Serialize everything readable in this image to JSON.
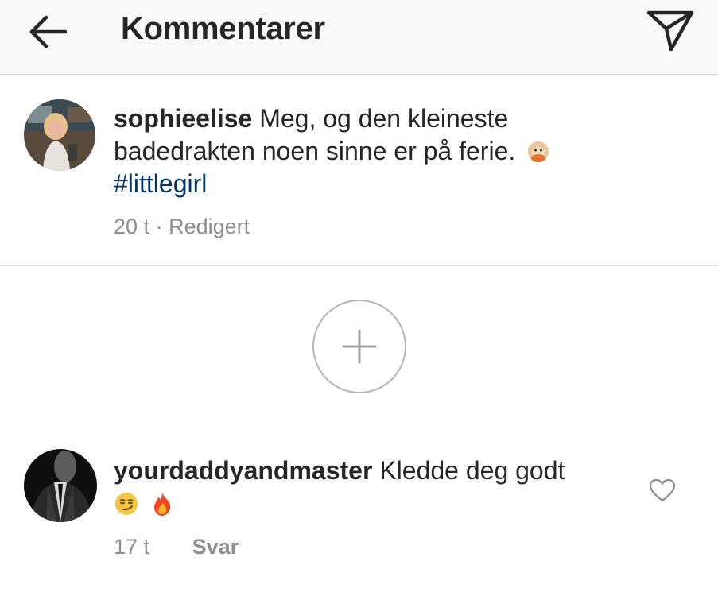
{
  "header": {
    "title": "Kommentarer",
    "back_icon": "arrow-left-icon",
    "send_icon": "paper-plane-icon"
  },
  "caption": {
    "username": "sophieelise",
    "text": "Meg, og den kleineste badedrakten noen sinne er på ferie.",
    "emoji": "🙊",
    "hashtag": "#littlegirl",
    "time": "20 t",
    "separator": "·",
    "edited": "Redigert"
  },
  "load_more": {
    "icon": "plus-circle-icon"
  },
  "comments": [
    {
      "username": "yourdaddyandmaster",
      "text": "Kledde deg godt",
      "emojis": [
        "😏",
        "🔥"
      ],
      "time": "17 t",
      "reply_label": "Svar",
      "like_icon": "heart-outline-icon"
    }
  ],
  "colors": {
    "text": "#262626",
    "muted": "#8e8e8e",
    "hashtag": "#003569",
    "header_bg": "#fafafa",
    "divider": "#dbdbdb"
  }
}
